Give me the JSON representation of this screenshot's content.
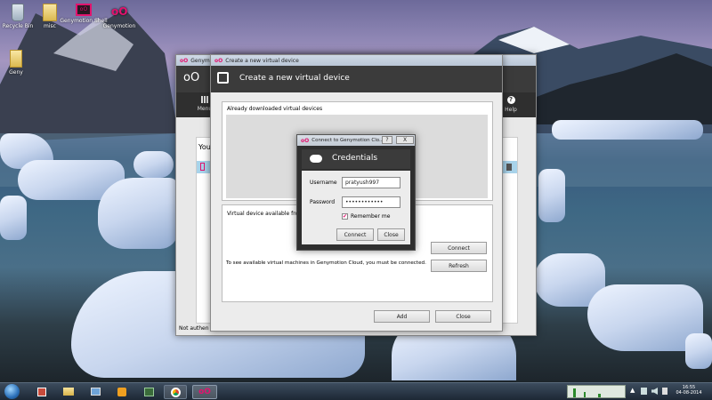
{
  "desktop_icons": [
    {
      "label": "Recycle Bin",
      "icon": "recycle-bin-icon"
    },
    {
      "label": "misc",
      "icon": "folder-icon"
    },
    {
      "label": "Genymotion Shell",
      "icon": "genymotion-shell-icon"
    },
    {
      "label": "Genymotion",
      "icon": "genymotion-icon"
    },
    {
      "label": "Geny",
      "icon": "folder-icon"
    }
  ],
  "main_window": {
    "title": "Genymotion",
    "logo_text": "oO",
    "menu_label": "Menu",
    "help_label": "Help",
    "your_label": "You",
    "status_text": "Not authen"
  },
  "create_dialog": {
    "titlebar_title": "Create a new virtual device",
    "header_title": "Create a new virtual device",
    "already_downloaded_label": "Already downloaded virtual devices",
    "available_from_label": "Virtual device available fro",
    "info_text": "To see available virtual machines in Genymotion Cloud, you must be connected.",
    "connect_label": "Connect",
    "refresh_label": "Refresh",
    "add_label": "Add",
    "close_label": "Close"
  },
  "credentials_dialog": {
    "titlebar_title": "Connect to Genymotion Clo...",
    "title_buttons": {
      "help": "?",
      "close": "X"
    },
    "header_title": "Credentials",
    "username_label": "Username",
    "username_value": "pratyush997",
    "password_label": "Password",
    "password_value": "••••••••••••",
    "remember_label": "Remember me",
    "remember_checked": true,
    "connect_label": "Connect",
    "close_label": "Close"
  },
  "taskbar": {
    "items": [
      "start-orb-icon",
      "app-icon",
      "explorer-folder-icon",
      "computer-icon",
      "media-player-icon",
      "terminal-icon",
      "chrome-icon",
      "genymotion-taskbar-icon"
    ],
    "clock_time": "16:55",
    "clock_date": "04-08-2014"
  },
  "colors": {
    "accent_pink": "#e2136e",
    "header_dark": "#3b3b3b",
    "selection_blue": "#a8d3ea"
  }
}
